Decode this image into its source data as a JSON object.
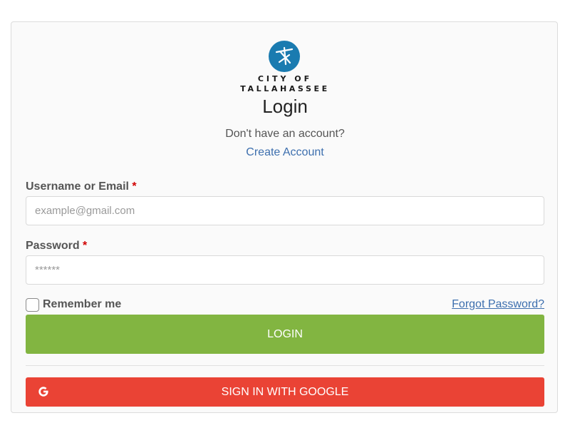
{
  "logo": {
    "line1": "CITY OF",
    "line2": "TALLAHASSEE",
    "icon": "tallahassee-star-logo-icon",
    "color": "#1a7bb0"
  },
  "title": "Login",
  "signup": {
    "prompt": "Don't have an account?",
    "link": "Create Account"
  },
  "form": {
    "username": {
      "label": "Username or Email",
      "required_mark": "*",
      "placeholder": "example@gmail.com",
      "value": ""
    },
    "password": {
      "label": "Password",
      "required_mark": "*",
      "placeholder": "******",
      "value": ""
    },
    "remember_label": "Remember me",
    "remember_checked": false,
    "forgot_link": "Forgot Password?",
    "login_button": "LOGIN"
  },
  "google": {
    "button_label": "SIGN IN WITH GOOGLE",
    "icon": "google-g-icon"
  },
  "colors": {
    "login_button": "#82b541",
    "google_button": "#ea4335",
    "link": "#3d6fae",
    "required": "#d00000"
  }
}
